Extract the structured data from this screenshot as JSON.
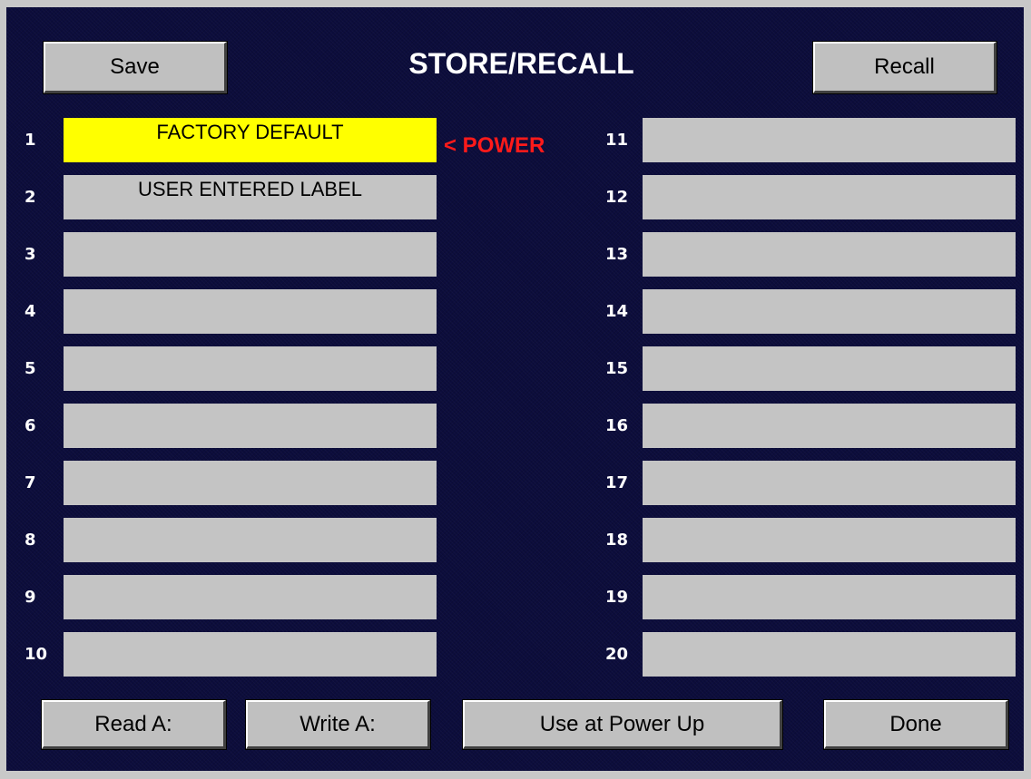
{
  "title": "STORE/RECALL",
  "buttons": {
    "save": "Save",
    "recall": "Recall",
    "read": "Read A:",
    "write": "Write A:",
    "use_power_up": "Use at Power Up",
    "done": "Done"
  },
  "power_marker": "< POWER",
  "colors": {
    "panel_background": "#0c0d3c",
    "slot_background": "#c4c4c4",
    "selected_slot": "#ffff00",
    "power_marker": "#ff1a1a"
  },
  "slots": [
    {
      "number": "1",
      "label": "FACTORY DEFAULT",
      "selected": true
    },
    {
      "number": "2",
      "label": "USER ENTERED LABEL"
    },
    {
      "number": "3",
      "label": ""
    },
    {
      "number": "4",
      "label": ""
    },
    {
      "number": "5",
      "label": ""
    },
    {
      "number": "6",
      "label": ""
    },
    {
      "number": "7",
      "label": ""
    },
    {
      "number": "8",
      "label": ""
    },
    {
      "number": "9",
      "label": ""
    },
    {
      "number": "10",
      "label": ""
    },
    {
      "number": "11",
      "label": ""
    },
    {
      "number": "12",
      "label": ""
    },
    {
      "number": "13",
      "label": ""
    },
    {
      "number": "14",
      "label": ""
    },
    {
      "number": "15",
      "label": ""
    },
    {
      "number": "16",
      "label": ""
    },
    {
      "number": "17",
      "label": ""
    },
    {
      "number": "18",
      "label": ""
    },
    {
      "number": "19",
      "label": ""
    },
    {
      "number": "20",
      "label": ""
    }
  ]
}
